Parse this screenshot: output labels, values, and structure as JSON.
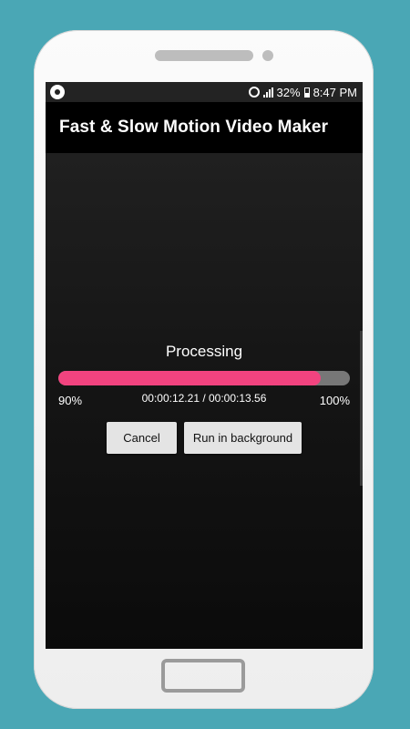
{
  "status_bar": {
    "battery": "32%",
    "time": "8:47 PM"
  },
  "app": {
    "title": "Fast & Slow Motion Video Maker"
  },
  "processing": {
    "label": "Processing",
    "progress": 0.9,
    "progress_percent": "90%",
    "max_percent": "100%",
    "elapsed_total": "00:00:12.21 / 00:00:13.56"
  },
  "buttons": {
    "cancel": "Cancel",
    "run_in_background": "Run in background"
  },
  "icons": {
    "status_app": "film-reel-icon",
    "alarm": "alarm-clock-icon",
    "signal": "signal-icon",
    "battery": "battery-icon"
  },
  "colors": {
    "progress_fill": "#f2437f",
    "progress_track": "#777777",
    "device_background": "#4aa7b5"
  }
}
